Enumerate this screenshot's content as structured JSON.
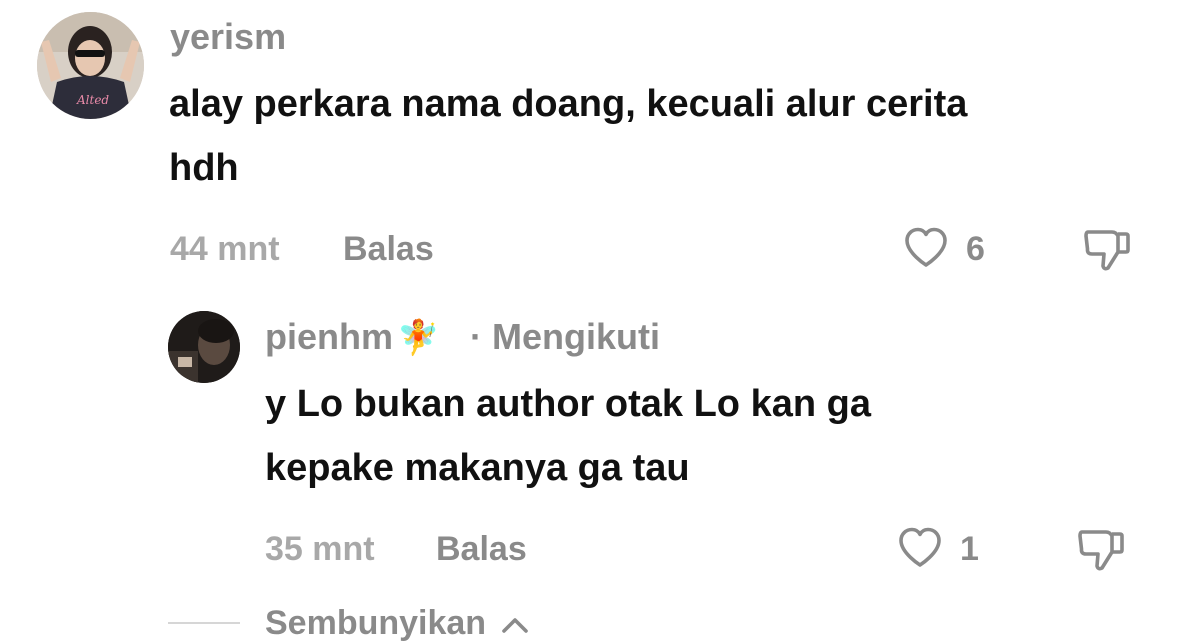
{
  "comments": [
    {
      "username": "yerism",
      "text_line1": "alay perkara nama doang, kecuali alur cerita",
      "text_line2": "hdh",
      "time": "44 mnt",
      "reply_label": "Balas",
      "like_count": "6"
    }
  ],
  "replies": [
    {
      "username": "pienhm",
      "emoji": "🧚",
      "separator": "·",
      "follow_status": "Mengikuti",
      "text_line1": "y Lo bukan author otak Lo kan ga",
      "text_line2": "kepake makanya ga tau",
      "time": "35 mnt",
      "reply_label": "Balas",
      "like_count": "1"
    }
  ],
  "hide_replies": {
    "label": "Sembunyikan",
    "icon": "chevron-up-icon"
  },
  "colors": {
    "text_primary": "#111111",
    "text_secondary": "#8a8a8a",
    "text_muted": "#a8a8a8"
  }
}
